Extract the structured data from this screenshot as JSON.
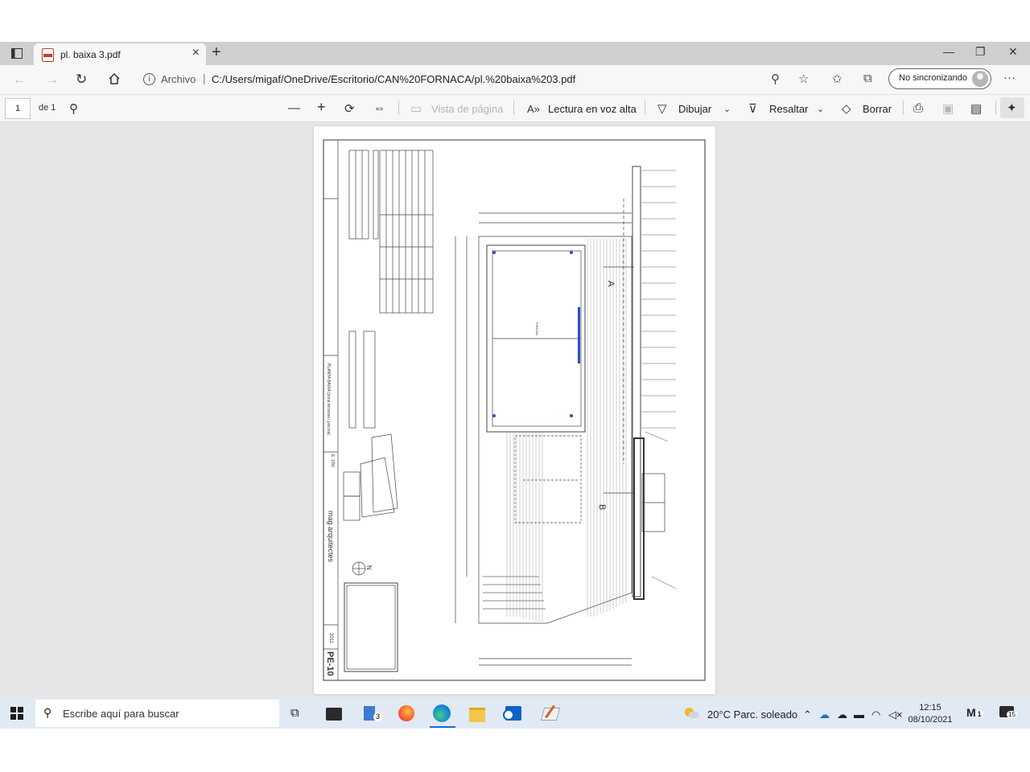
{
  "browser": {
    "tab_title": "pl. baixa 3.pdf",
    "tab_close": "×",
    "new_tab": "+",
    "address_label": "Archivo",
    "address_sep": "|",
    "url": "C:/Users/migaf/OneDrive/Escritorio/CAN%20FORNACA/pl.%20baixa%203.pdf",
    "sync_label": "No sincronizando",
    "more": "···"
  },
  "pdf_toolbar": {
    "page_current": "1",
    "page_total": "de 1",
    "page_view": "Vista de página",
    "read_aloud": "Lectura en voz alta",
    "draw": "Dibujar",
    "highlight": "Resaltar",
    "erase": "Borrar"
  },
  "drawing": {
    "sheet": "PE-10",
    "studio": "mag arquitectes",
    "plan_title": "PLANTA BAIXA (zona terrassa i piscina)",
    "scale": "E: 1/50",
    "year": "2011",
    "label_a": "A",
    "label_b": "B",
    "north": "N",
    "pool_label": "PISCINA"
  },
  "taskbar": {
    "search_placeholder": "Escribe aquí para buscar",
    "weather": "20°C  Parc. soleado",
    "time": "12:15",
    "date": "08/10/2021",
    "notif_count": "15",
    "badge_1": "3",
    "badge_2": "1"
  }
}
